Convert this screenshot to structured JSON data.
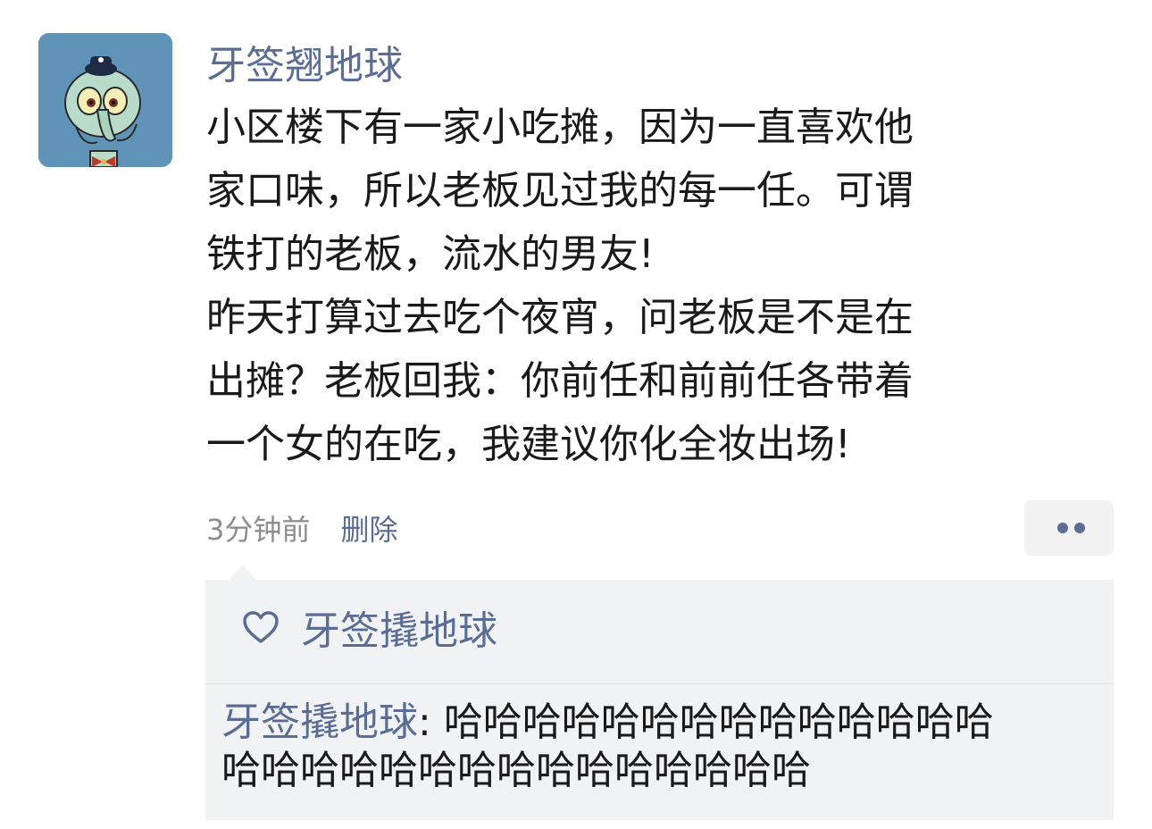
{
  "post": {
    "author": "牙签翘地球",
    "text_lines": [
      "小区楼下有一家小吃摊，因为一直喜欢他",
      "家口味，所以老板见过我的每一任。可谓",
      "铁打的老板，流水的男友!",
      "昨天打算过去吃个夜宵，问老板是不是在",
      "出摊？老板回我：你前任和前前任各带着",
      "一个女的在吃，我建议你化全妆出场!"
    ],
    "time": "3分钟前",
    "delete_label": "删除",
    "more_icon": "more-dots-icon"
  },
  "likes": {
    "icon": "heart-icon",
    "names": "牙签撬地球"
  },
  "comments": [
    {
      "author": "牙签撬地球",
      "separator": ": ",
      "line1": "哈哈哈哈哈哈哈哈哈哈哈哈哈哈",
      "line2": "哈哈哈哈哈哈哈哈哈哈哈哈哈哈哈"
    }
  ],
  "colors": {
    "link": "#5a6d95",
    "text": "#1a1a1a",
    "meta": "#8d8d8d",
    "reply_bg": "#f1f2f4",
    "avatar_bg": "#5f93b7"
  }
}
